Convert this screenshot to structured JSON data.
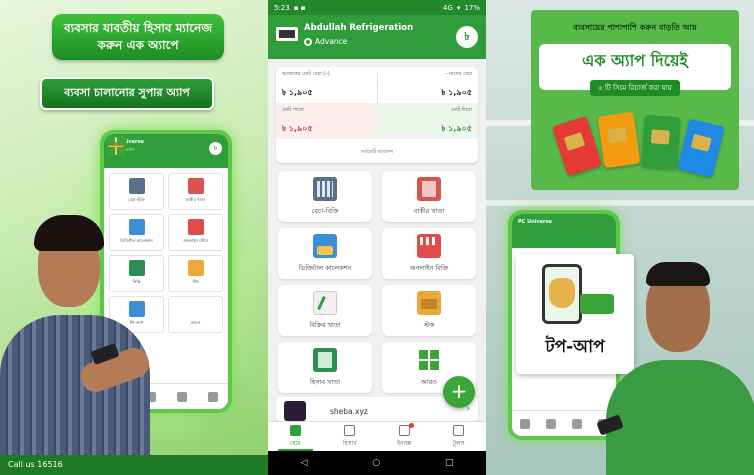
{
  "left_panel": {
    "headline": "ব্যবসার যাবতীয় হিসাব ম্যানেজ করুন এক অ্যাপে",
    "tagline": "ব্যবসা চালানোর সুপার অ্যাপ",
    "mini_app": {
      "title": "PC Universe",
      "subtitle": "সুপার অ্যাডমিন",
      "taka_symbol": "৳",
      "tiles": [
        "বেচা-বিক্রি",
        "বাকীর খাতা",
        "ডিজিটাল কালেকশন",
        "অনলাইন স্টোর",
        "কিস্তি",
        "স্টক",
        "টপ-আপ",
        "আরও"
      ]
    },
    "call_text": "Call us 16516"
  },
  "phone": {
    "status_bar": {
      "time": "5:23",
      "network": "4G",
      "battery": "17%"
    },
    "app_bar": {
      "business_name": "Abdullah Refrigeration",
      "tier": "Advance",
      "taka_icon": "৳"
    },
    "summary": {
      "cells": [
        {
          "label": "আজকের মোট বেচা (–)",
          "value": "৳ ১,৯০৫"
        },
        {
          "label": "– মাসের বেচা",
          "value": "৳ ১,৯০৫"
        },
        {
          "label": "মোট পাবো",
          "value": "৳ ১,৯০৫"
        },
        {
          "label": "মোট দিবো",
          "value": "৳ ১,৯০৫"
        }
      ],
      "footer": "সর্বমোট ব্যালেন্স"
    },
    "tiles": [
      {
        "label": "বেচা-বিক্রি",
        "icon": "calculator-icon"
      },
      {
        "label": "বাকীর খাতা",
        "icon": "ledger-book-icon"
      },
      {
        "label": "ডিজিটাল কালেকশন",
        "icon": "digital-collection-icon"
      },
      {
        "label": "অনলাইন বিক্রি",
        "icon": "online-store-icon"
      },
      {
        "label": "বিক্রির খাতা",
        "icon": "sales-book-icon"
      },
      {
        "label": "স্টক",
        "icon": "stock-box-icon"
      },
      {
        "label": "হিসাব খাতা",
        "icon": "account-book-icon"
      },
      {
        "label": "আরও",
        "icon": "more-grid-icon"
      }
    ],
    "promo": {
      "label": "sheba.xyz"
    },
    "fab_symbol": "+",
    "bottom_nav": [
      {
        "label": "হোম",
        "active": true
      },
      {
        "label": "হিসাব",
        "active": false
      },
      {
        "label": "ইনবক্স",
        "active": false
      },
      {
        "label": "টুলস",
        "active": false
      }
    ],
    "system_nav": [
      "◁",
      "○",
      "□"
    ]
  },
  "right_panel": {
    "banner_top": "ব্যবসায়ের পাশাপাশি করুন বাড়তি আয়",
    "banner_main": "এক অ্যাপ দিয়েই",
    "banner_sub": "৫ টি সিমে রিচার্জ করা যায়",
    "sim_colors": [
      "#e53935",
      "#f39c12",
      "#2f9e3a",
      "#1e88e5"
    ],
    "mini_app_title": "PC Universe",
    "topup_label": "টপ-আপ"
  }
}
